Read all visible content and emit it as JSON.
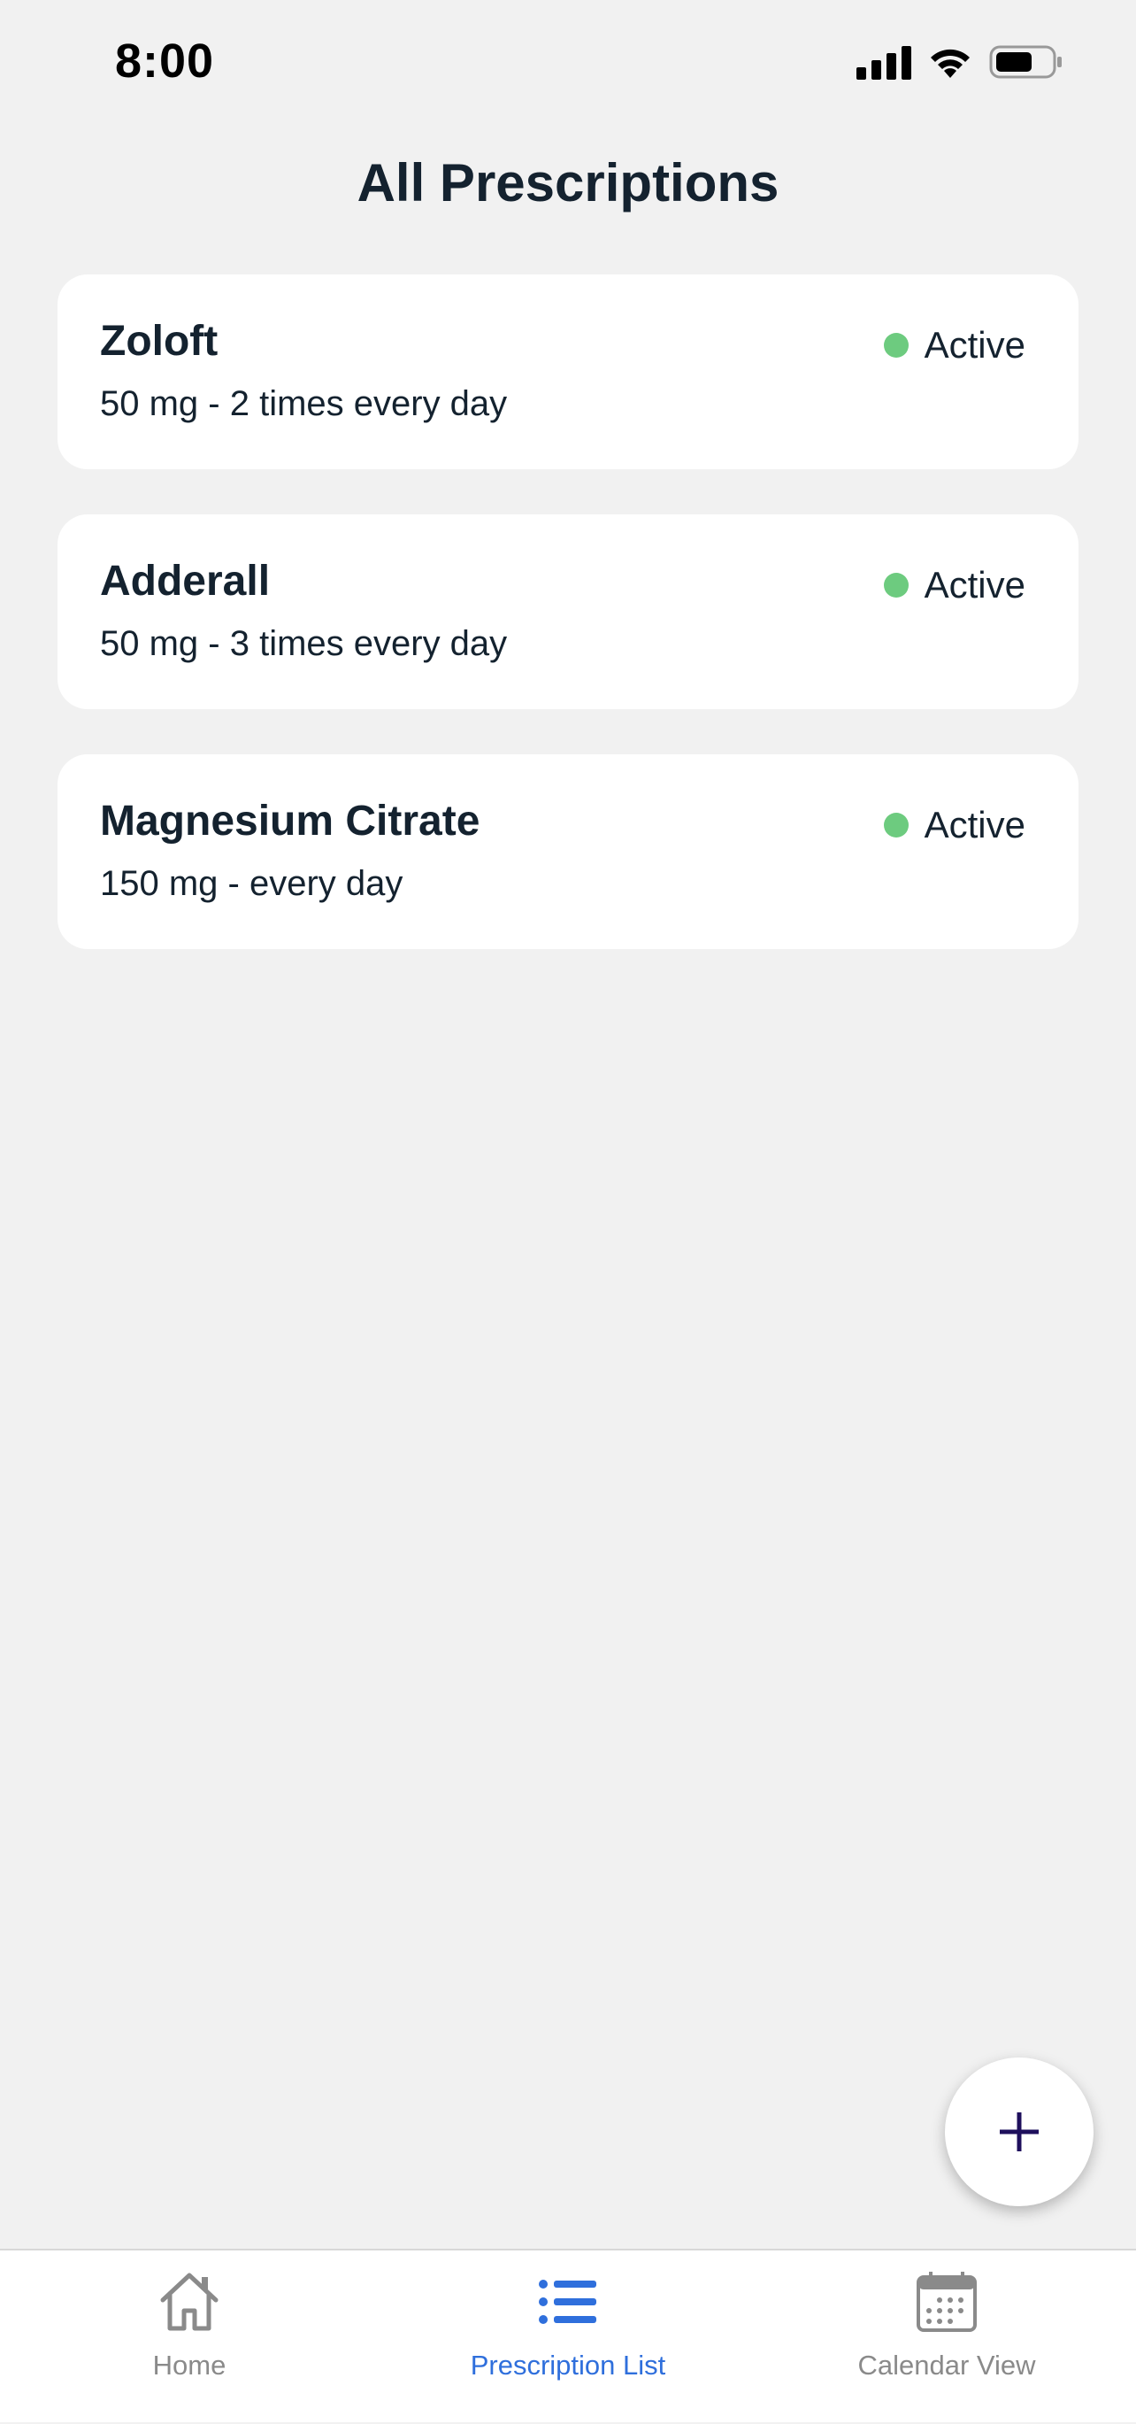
{
  "status_bar": {
    "time": "8:00"
  },
  "page": {
    "title": "All Prescriptions"
  },
  "prescriptions": [
    {
      "name": "Zoloft",
      "detail": "50 mg - 2 times every day",
      "status": "Active"
    },
    {
      "name": "Adderall",
      "detail": "50 mg - 3 times every day",
      "status": "Active"
    },
    {
      "name": "Magnesium Citrate",
      "detail": "150 mg - every day",
      "status": "Active"
    }
  ],
  "fab": {
    "icon": "plus-icon"
  },
  "tabs": [
    {
      "label": "Home",
      "icon": "home-icon",
      "active": false
    },
    {
      "label": "Prescription List",
      "icon": "list-icon",
      "active": true
    },
    {
      "label": "Calendar View",
      "icon": "calendar-icon",
      "active": false
    }
  ],
  "colors": {
    "background": "#f1f1f1",
    "card": "#ffffff",
    "text": "#14222f",
    "active_dot": "#6dcb7f",
    "tab_active": "#2f6fdc",
    "tab_inactive": "#8a8a8a",
    "fab_plus": "#1e0f5c"
  }
}
